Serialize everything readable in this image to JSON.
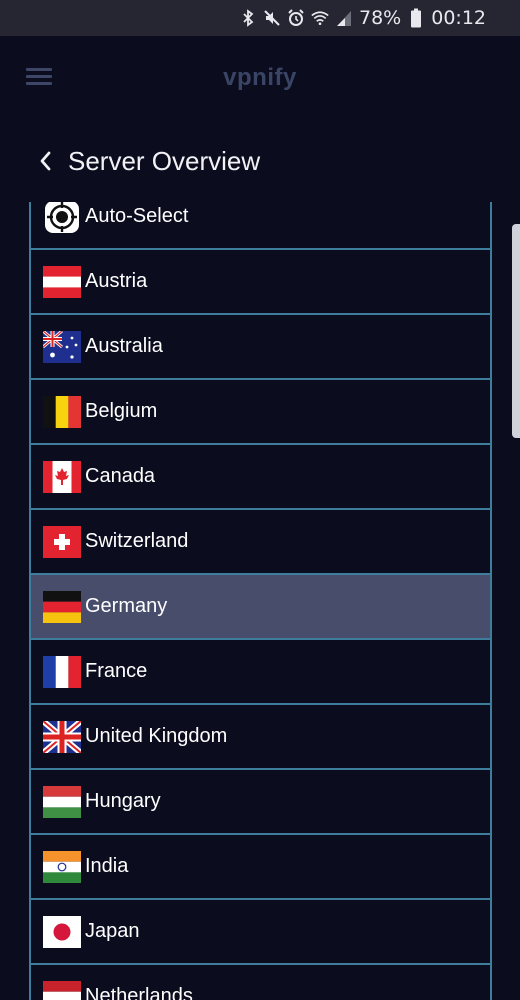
{
  "status_bar": {
    "battery": "78%",
    "time": "00:12",
    "icons": [
      "bluetooth-icon",
      "mute-icon",
      "alarm-icon",
      "wifi-icon",
      "signal-icon",
      "battery-icon"
    ]
  },
  "app_bar": {
    "title": "vpnify",
    "menu_icon": "hamburger-icon"
  },
  "page": {
    "title": "Server Overview",
    "back_icon": "chevron-left-icon"
  },
  "servers": [
    {
      "label": "Auto-Select",
      "icon": "target-icon"
    },
    {
      "label": "Austria",
      "icon": "flag-austria-icon"
    },
    {
      "label": "Australia",
      "icon": "flag-australia-icon"
    },
    {
      "label": "Belgium",
      "icon": "flag-belgium-icon"
    },
    {
      "label": "Canada",
      "icon": "flag-canada-icon"
    },
    {
      "label": "Switzerland",
      "icon": "flag-switzerland-icon"
    },
    {
      "label": "Germany",
      "icon": "flag-germany-icon",
      "selected": true
    },
    {
      "label": "France",
      "icon": "flag-france-icon"
    },
    {
      "label": "United Kingdom",
      "icon": "flag-uk-icon"
    },
    {
      "label": "Hungary",
      "icon": "flag-hungary-icon"
    },
    {
      "label": "India",
      "icon": "flag-india-icon"
    },
    {
      "label": "Japan",
      "icon": "flag-japan-icon"
    },
    {
      "label": "Netherlands",
      "icon": "flag-netherlands-icon"
    }
  ],
  "colors": {
    "background": "#0b0d1f",
    "row_divider": "#3e7e9c",
    "selected_row": "#474d6b",
    "app_title": "#3a4566"
  }
}
